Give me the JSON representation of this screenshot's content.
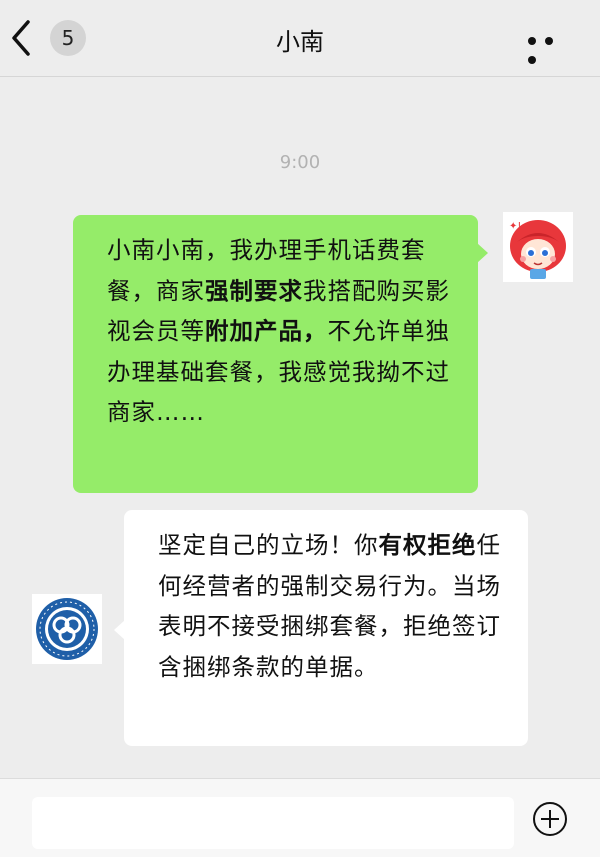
{
  "header": {
    "back_icon": "chevron-left-icon",
    "unread_count": "5",
    "title": "小南",
    "more_icon": "more-dots-icon"
  },
  "chat": {
    "timestamp": "9:00",
    "messages": [
      {
        "sender": "me",
        "avatar": "cartoon-girl-avatar",
        "segments": [
          {
            "text": "小南小南，我办理手机话费套餐，商家",
            "bold": false
          },
          {
            "text": "强制要求",
            "bold": true
          },
          {
            "text": "我搭配购买影视会员等",
            "bold": false
          },
          {
            "text": "附加产品，",
            "bold": true
          },
          {
            "text": "不允许单独办理基础套餐，我感觉我拗不过商家……",
            "bold": false
          }
        ]
      },
      {
        "sender": "other",
        "avatar": "university-logo-avatar",
        "segments": [
          {
            "text": "坚定自己的立场！你",
            "bold": false
          },
          {
            "text": "有权拒绝",
            "bold": true
          },
          {
            "text": "任何经营者的强制交易行为。当场表明不接受捆绑套餐，拒绝签订含捆绑条款的单据。",
            "bold": false
          }
        ]
      }
    ]
  },
  "composer": {
    "input_value": "",
    "add_icon": "plus-circle-icon"
  },
  "colors": {
    "my_bubble": "#95ec69",
    "other_bubble": "#ffffff",
    "background": "#ededed"
  }
}
